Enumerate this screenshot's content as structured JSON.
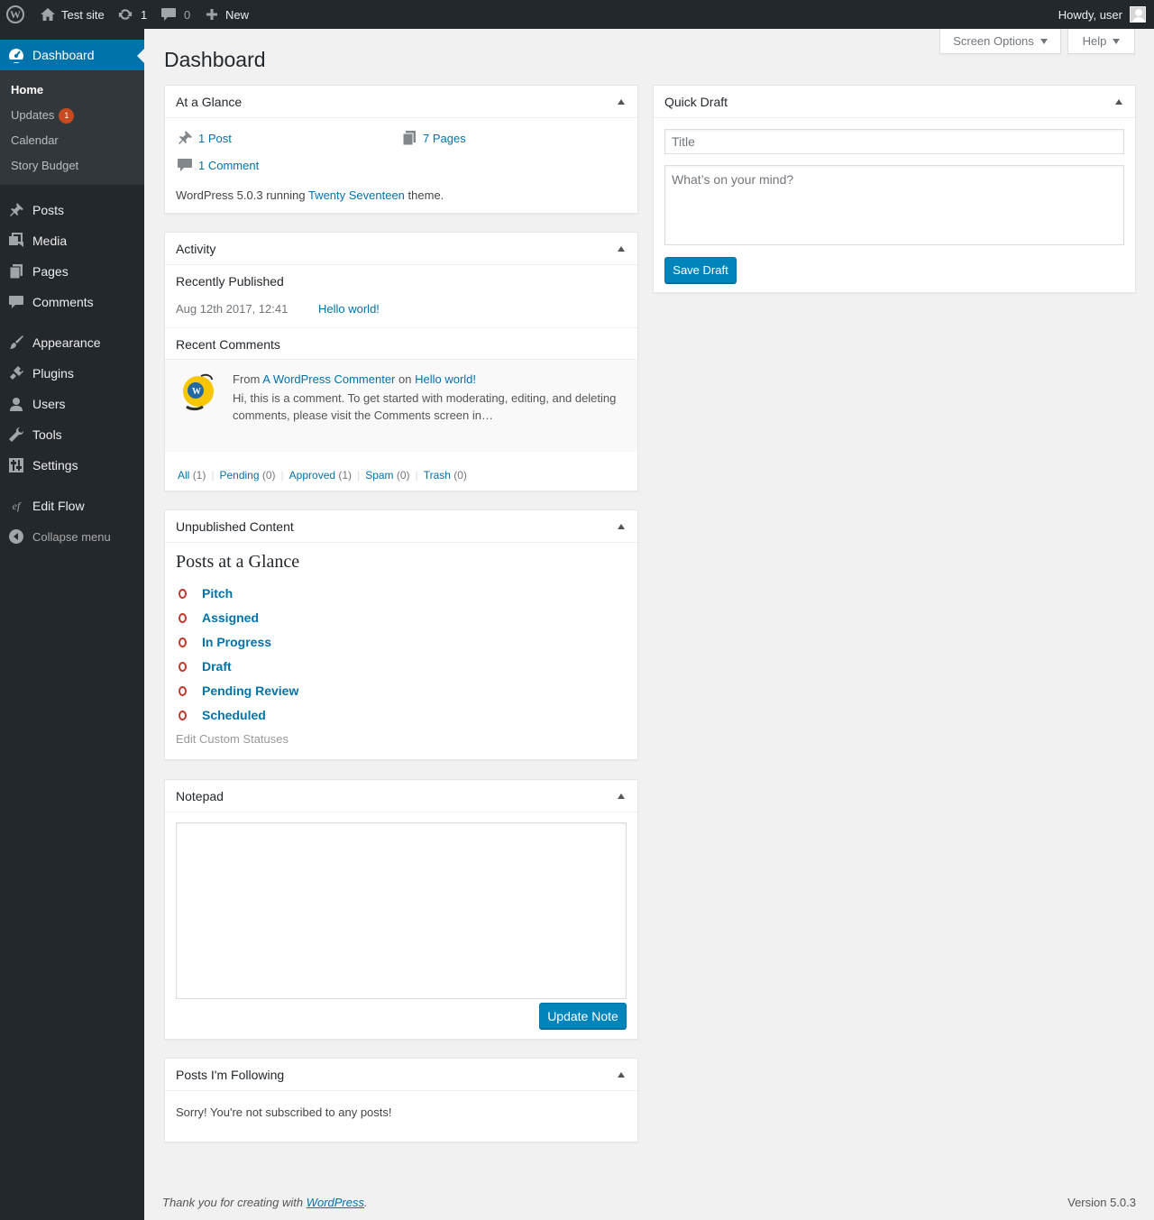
{
  "adminbar": {
    "site_name": "Test site",
    "updates_count": "1",
    "comments_count": "0",
    "new_label": "New",
    "howdy": "Howdy, user"
  },
  "menu": {
    "dashboard": "Dashboard",
    "submenu": [
      {
        "label": "Home"
      },
      {
        "label": "Updates",
        "badge": "1"
      },
      {
        "label": "Calendar"
      },
      {
        "label": "Story Budget"
      }
    ],
    "items": [
      {
        "label": "Posts",
        "icon": "pushpin-icon"
      },
      {
        "label": "Media",
        "icon": "media-icon"
      },
      {
        "label": "Pages",
        "icon": "pages-icon"
      },
      {
        "label": "Comments",
        "icon": "comment-icon"
      },
      {
        "label": "Appearance",
        "icon": "paintbrush-icon"
      },
      {
        "label": "Plugins",
        "icon": "plugin-icon"
      },
      {
        "label": "Users",
        "icon": "user-icon"
      },
      {
        "label": "Tools",
        "icon": "wrench-icon"
      },
      {
        "label": "Settings",
        "icon": "settings-icon"
      },
      {
        "label": "Edit Flow",
        "icon": "edit-flow-icon"
      }
    ],
    "collapse": "Collapse menu"
  },
  "screen_options": "Screen Options",
  "help": "Help",
  "page_title": "Dashboard",
  "at_a_glance": {
    "title": "At a Glance",
    "posts": "1 Post",
    "pages": "7 Pages",
    "comments": "1 Comment",
    "running_prefix": "WordPress 5.0.3 running",
    "theme": "Twenty Seventeen",
    "running_suffix": "theme."
  },
  "activity": {
    "title": "Activity",
    "recently_published": "Recently Published",
    "pub_date": "Aug 12th 2017, 12:41",
    "pub_title": "Hello world!",
    "recent_comments": "Recent Comments",
    "comment_from": "From",
    "comment_author": "A WordPress Commenter",
    "comment_on": "on",
    "comment_post": "Hello world!",
    "comment_text_1": "Hi, this is a comment. To get started with moderating, editing, and deleting",
    "comment_text_2": "comments, please visit the Comments screen in…",
    "filters": [
      {
        "label": "All",
        "count": "(1)"
      },
      {
        "label": "Pending",
        "count": "(0)"
      },
      {
        "label": "Approved",
        "count": "(1)"
      },
      {
        "label": "Spam",
        "count": "(0)"
      },
      {
        "label": "Trash",
        "count": "(0)"
      }
    ]
  },
  "unpublished": {
    "title": "Unpublished Content",
    "heading": "Posts at a Glance",
    "statuses": [
      {
        "count": "0",
        "label": "Pitch"
      },
      {
        "count": "0",
        "label": "Assigned"
      },
      {
        "count": "0",
        "label": "In Progress"
      },
      {
        "count": "0",
        "label": "Draft"
      },
      {
        "count": "0",
        "label": "Pending Review"
      },
      {
        "count": "0",
        "label": "Scheduled"
      }
    ],
    "edit_link": "Edit Custom Statuses"
  },
  "notepad": {
    "title": "Notepad",
    "value": "",
    "button": "Update Note"
  },
  "following": {
    "title": "Posts I'm Following",
    "message": "Sorry! You're not subscribed to any posts!"
  },
  "quick_draft": {
    "title": "Quick Draft",
    "title_placeholder": "Title",
    "content_placeholder": "What’s on your mind?",
    "button": "Save Draft"
  },
  "footer": {
    "thanks_prefix": "Thank you for creating with",
    "thanks_link": "WordPress",
    "thanks_suffix": ".",
    "version": "Version 5.0.3"
  },
  "colors": {
    "accent": "#0073aa",
    "adminbar_bg": "#23282d",
    "badge": "#ca4a1f",
    "status_ring": "#c0392b"
  }
}
